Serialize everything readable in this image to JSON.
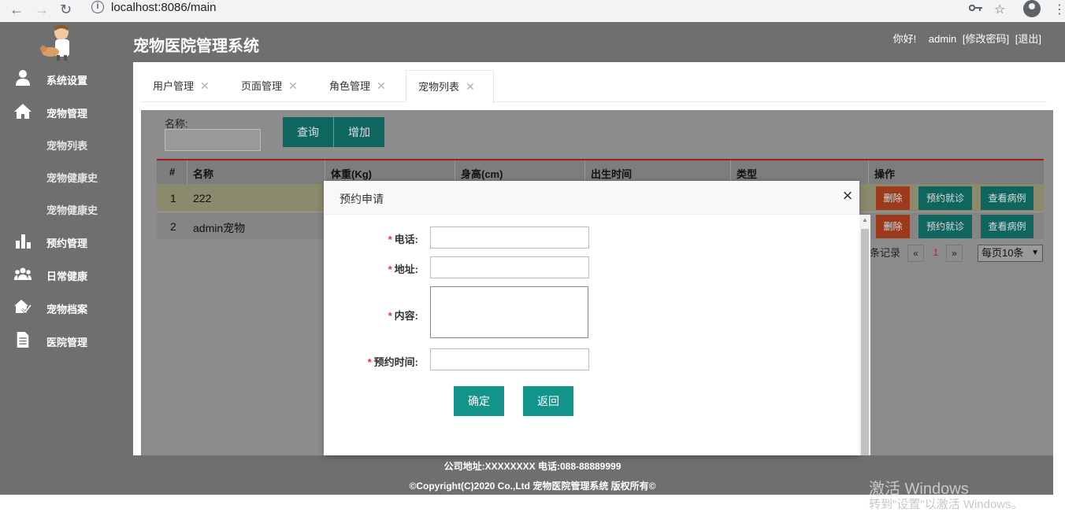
{
  "browser": {
    "back": "←",
    "forward": "→",
    "reload": "↻",
    "url": "localhost:8086/main",
    "key_icon": "key-icon",
    "star": "☆",
    "menu": "⋮"
  },
  "header": {
    "title": "宠物医院管理系统",
    "greeting": "你好!",
    "username": "admin",
    "change_password": "[修改密码]",
    "logout": "[退出]"
  },
  "sidebar": {
    "items": [
      {
        "label": "系统设置",
        "icon": "user-icon"
      },
      {
        "label": "宠物管理",
        "icon": "home-icon"
      },
      {
        "label": "预约管理",
        "icon": "bar-chart-icon"
      },
      {
        "label": "日常健康",
        "icon": "group-icon"
      },
      {
        "label": "宠物档案",
        "icon": "house-check-icon"
      },
      {
        "label": "医院管理",
        "icon": "document-icon"
      }
    ],
    "sub_items": [
      "宠物列表",
      "宠物健康史",
      "宠物健康史"
    ]
  },
  "tabs": [
    {
      "label": "用户管理",
      "close": "✕"
    },
    {
      "label": "页面管理",
      "close": "✕"
    },
    {
      "label": "角色管理",
      "close": "✕"
    },
    {
      "label": "宠物列表",
      "close": "✕"
    }
  ],
  "search": {
    "label": "名称:",
    "value": "",
    "query_button": "查询",
    "add_button": "增加"
  },
  "table": {
    "headers": [
      "#",
      "名称",
      "体重(Kg)",
      "身高(cm)",
      "出生时间",
      "类型",
      "操作"
    ],
    "rows": [
      {
        "index": "1",
        "name": "222"
      },
      {
        "index": "2",
        "name": "admin宠物"
      }
    ],
    "actions": {
      "delete": "删除",
      "appointment": "预约就诊",
      "records": "查看病例"
    }
  },
  "pager": {
    "records_text": "条记录",
    "prev": "«",
    "page": "1",
    "next": "»",
    "page_size": "每页10条"
  },
  "modal": {
    "title": "预约申请",
    "close": "×",
    "required_mark": "*",
    "fields": {
      "phone": "电话:",
      "address": "地址:",
      "content": "内容:",
      "time": "预约时间:"
    },
    "confirm": "确定",
    "back": "返回"
  },
  "footer": {
    "line1": "公司地址:XXXXXXXX 电话:088-88889999",
    "line2": "©Copyright(C)2020 Co.,Ltd 宠物医院管理系统 版权所有©"
  },
  "watermark": {
    "line1": "激活 Windows",
    "line2": "转到\"设置\"以激活 Windows。"
  },
  "colors": {
    "header_bg": "#6f6f6f",
    "accent_green": "#12948a",
    "delete_red": "#9c3a1d",
    "required_red": "#ee3333"
  }
}
